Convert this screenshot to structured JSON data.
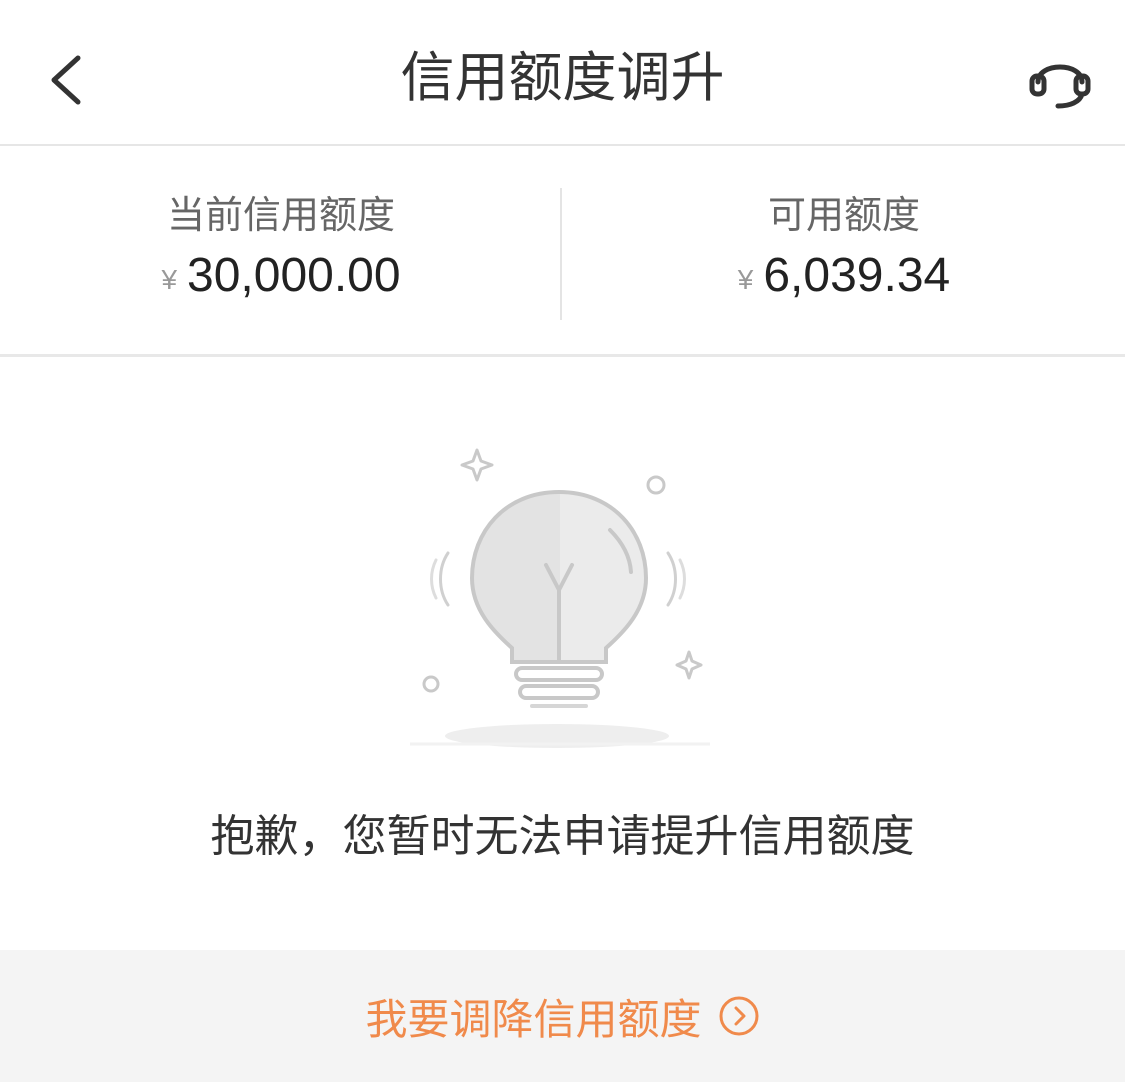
{
  "header": {
    "title": "信用额度调升",
    "back_icon": "back-arrow-icon",
    "service_icon": "customer-service-icon"
  },
  "summary": {
    "current": {
      "label": "当前信用额度",
      "currency": "¥",
      "amount": "30,000.00"
    },
    "available": {
      "label": "可用额度",
      "currency": "¥",
      "amount": "6,039.34"
    }
  },
  "illustration": {
    "icon": "lightbulb-icon"
  },
  "message": "抱歉，您暂时无法申请提升信用额度",
  "bottom": {
    "link_label": "我要调降信用额度",
    "link_icon": "chevron-right-circle-icon",
    "accent_color": "#f08a4b"
  }
}
